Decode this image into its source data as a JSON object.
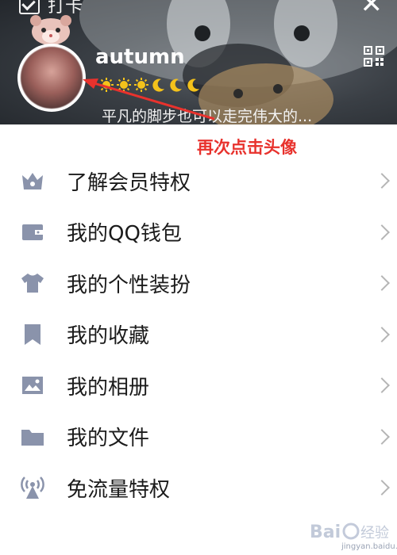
{
  "header": {
    "checkin_label": "打卡",
    "username": "autumn",
    "signature": "平凡的脚步也可以走完伟大的...",
    "level_icons": [
      "sun-icon",
      "sun-icon",
      "sun-icon",
      "moon-icon",
      "moon-icon",
      "moon-icon"
    ]
  },
  "annotation": {
    "text": "再次点击头像",
    "color": "#e8322d"
  },
  "menu": {
    "items": [
      {
        "label": "了解会员特权",
        "icon": "crown-icon"
      },
      {
        "label": "我的QQ钱包",
        "icon": "wallet-icon"
      },
      {
        "label": "我的个性装扮",
        "icon": "shirt-icon"
      },
      {
        "label": "我的收藏",
        "icon": "bookmark-icon"
      },
      {
        "label": "我的相册",
        "icon": "picture-icon"
      },
      {
        "label": "我的文件",
        "icon": "folder-icon"
      },
      {
        "label": "免流量特权",
        "icon": "antenna-icon"
      }
    ]
  },
  "colors": {
    "icon": "#8a93ab",
    "accent": "#e8322d"
  },
  "watermark": {
    "logo_text": "Bai 经验",
    "url": "jingyan.baidu.com"
  }
}
